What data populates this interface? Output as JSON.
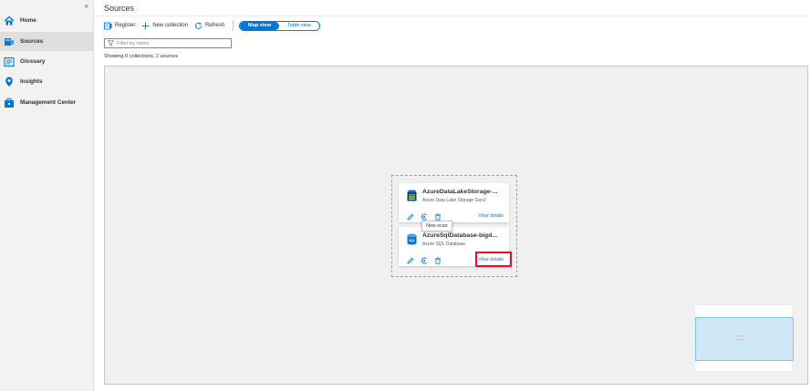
{
  "sidebar": {
    "collapse_glyph": "«",
    "items": [
      {
        "label": "Home",
        "icon": "home-icon",
        "active": false
      },
      {
        "label": "Sources",
        "icon": "sources-icon",
        "active": true
      },
      {
        "label": "Glossary",
        "icon": "glossary-icon",
        "active": false
      },
      {
        "label": "Insights",
        "icon": "insights-icon",
        "active": false
      },
      {
        "label": "Management Center",
        "icon": "management-center-icon",
        "active": false
      }
    ]
  },
  "header": {
    "title": "Sources"
  },
  "toolbar": {
    "register_label": "Register",
    "new_collection_label": "New collection",
    "refresh_label": "Refresh",
    "map_view_label": "Map view",
    "table_view_label": "Table view",
    "selected_view": "Map view"
  },
  "filter": {
    "placeholder": "Filter by name",
    "value": ""
  },
  "summary": {
    "text": "Showing 0 collections, 2 sources"
  },
  "sources": [
    {
      "name": "AzureDataLakeStorage-...",
      "type": "Azure Data Lake Storage Gen2",
      "view_details_label": "View details",
      "icon": "data-lake-storage-icon"
    },
    {
      "name": "AzureSqlDatabase-bigd...",
      "type": "Azure SQL Database",
      "view_details_label": "View details",
      "icon": "sql-database-icon"
    }
  ],
  "tooltip": {
    "text": "New scan"
  },
  "colors": {
    "accent": "#0078d4",
    "highlight": "#e81123",
    "sidebar_bg": "#f3f2f1",
    "canvas_bg": "#f0f0f0"
  }
}
